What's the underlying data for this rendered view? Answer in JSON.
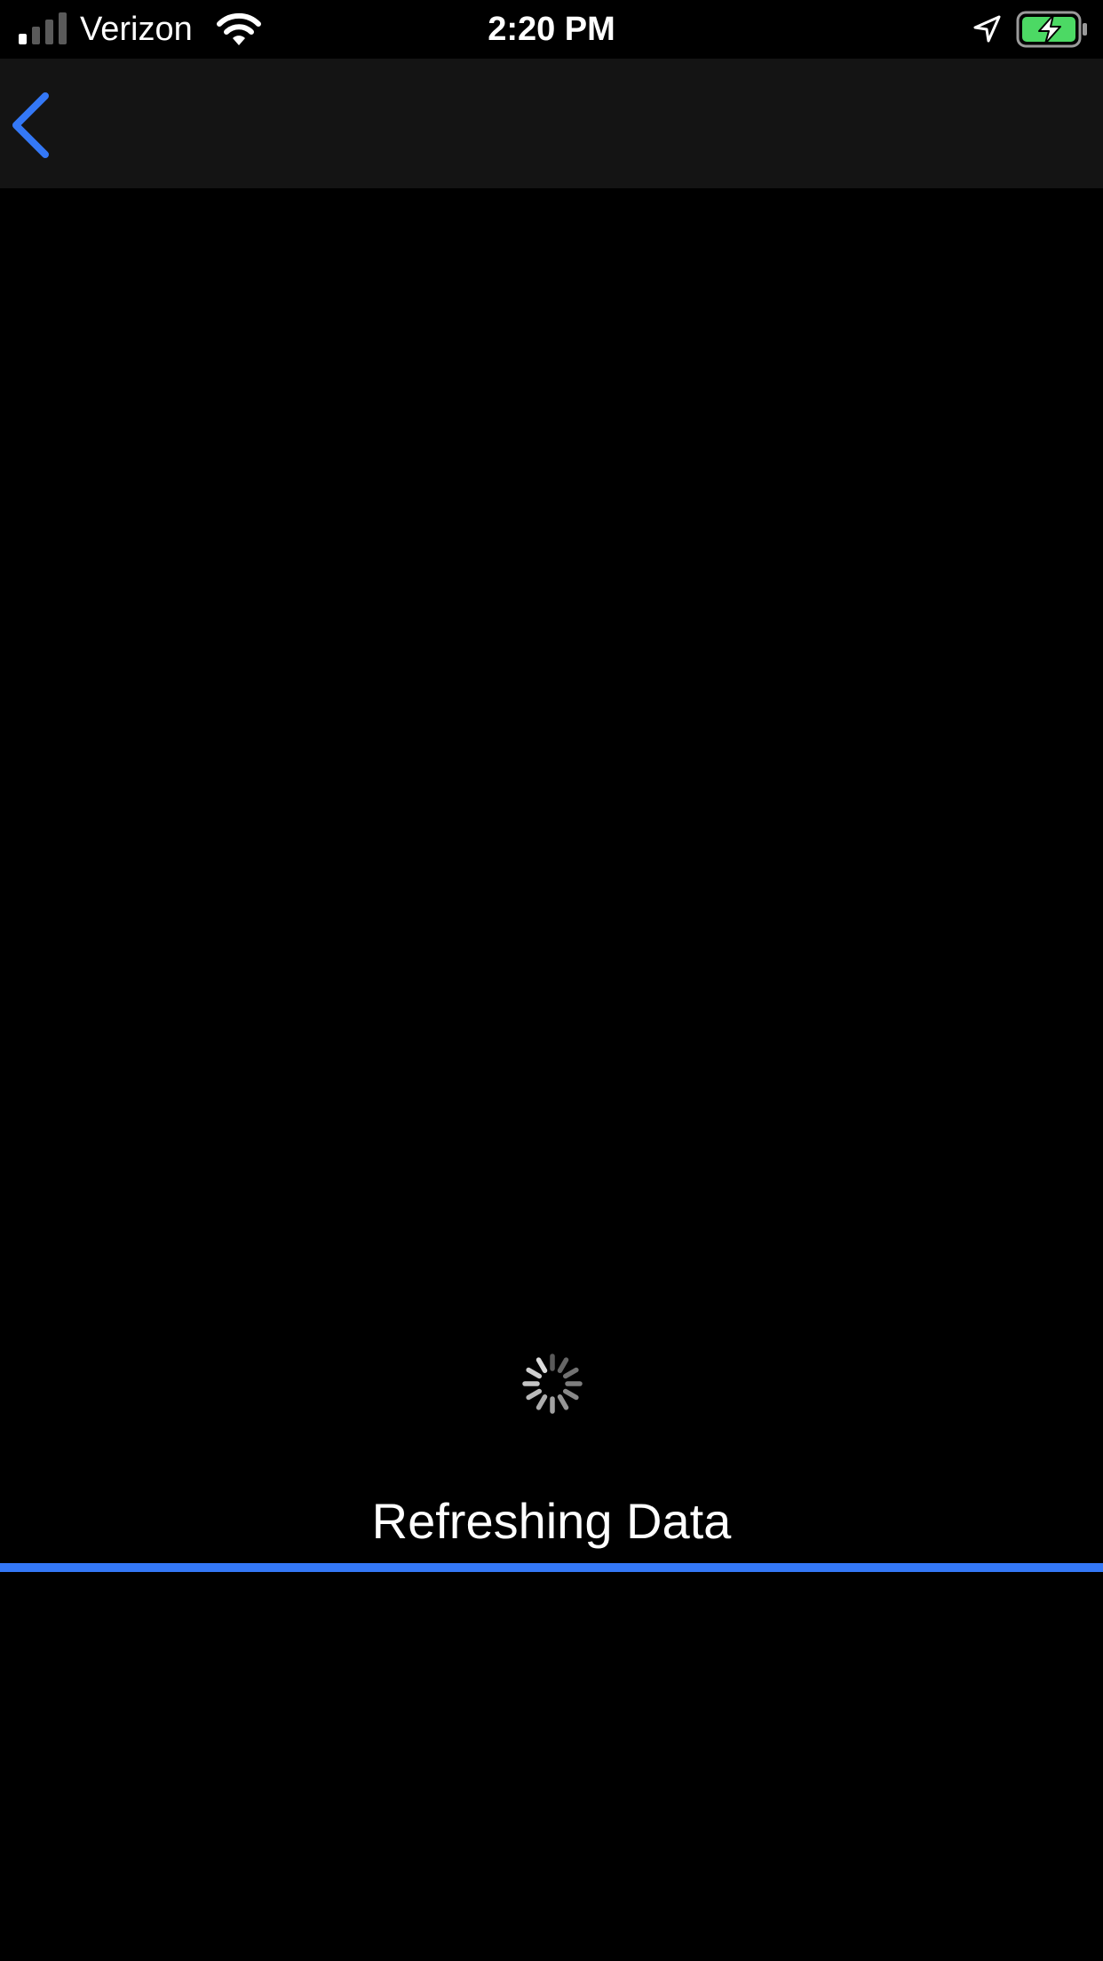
{
  "status_bar": {
    "carrier": "Verizon",
    "time": "2:20 PM",
    "signal_bars_active": 1,
    "signal_bars_total": 4,
    "icons": [
      "signal-icon",
      "wifi-icon",
      "location-arrow-icon",
      "battery-charging-icon"
    ]
  },
  "nav": {
    "back_icon": "chevron-left-icon"
  },
  "loading": {
    "label": "Refreshing Data",
    "spinner_icon": "activity-spinner-icon",
    "progress_fraction": 1.0
  },
  "colors": {
    "background": "#000000",
    "nav_background": "#141414",
    "accent": "#3478f6",
    "battery_charging": "#4cd964",
    "text": "#ffffff"
  }
}
